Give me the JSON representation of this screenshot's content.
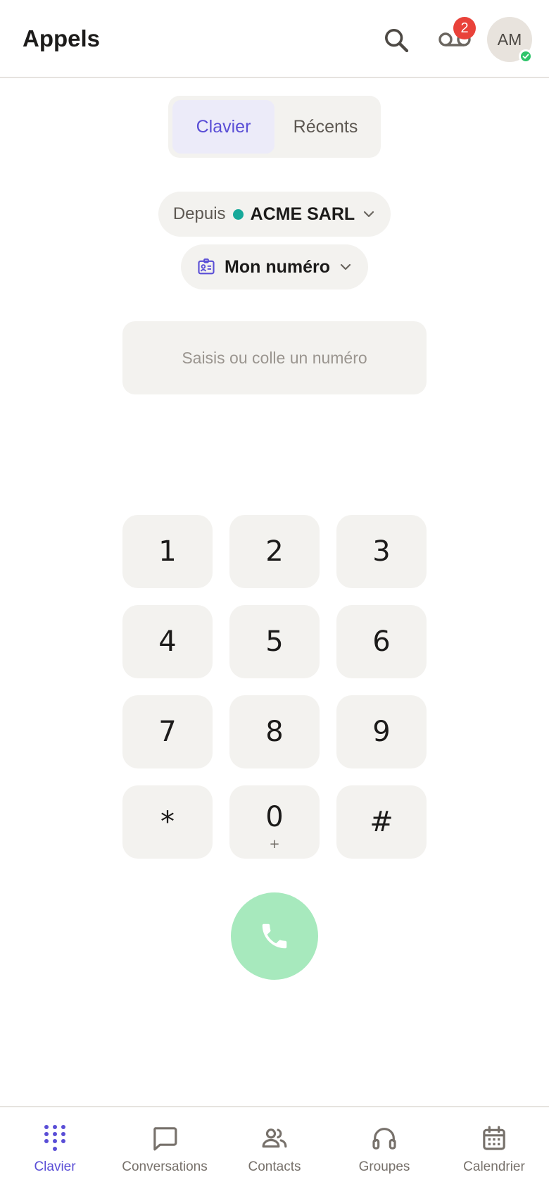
{
  "header": {
    "title": "Appels",
    "voicemail_count": "2",
    "avatar_initials": "AM"
  },
  "tabs": [
    {
      "label": "Clavier",
      "active": true
    },
    {
      "label": "Récents",
      "active": false
    }
  ],
  "caller": {
    "from_label": "Depuis",
    "company": "ACME SARL",
    "company_dot_color": "#17a99a",
    "number_label": "Mon numéro"
  },
  "dial_input": {
    "value": "",
    "placeholder": "Saisis ou colle un numéro"
  },
  "keypad": [
    {
      "digit": "1",
      "sub": ""
    },
    {
      "digit": "2",
      "sub": ""
    },
    {
      "digit": "3",
      "sub": ""
    },
    {
      "digit": "4",
      "sub": ""
    },
    {
      "digit": "5",
      "sub": ""
    },
    {
      "digit": "6",
      "sub": ""
    },
    {
      "digit": "7",
      "sub": ""
    },
    {
      "digit": "8",
      "sub": ""
    },
    {
      "digit": "9",
      "sub": ""
    },
    {
      "digit": "*",
      "sub": ""
    },
    {
      "digit": "0",
      "sub": "+"
    },
    {
      "digit": "#",
      "sub": ""
    }
  ],
  "call_button": {
    "icon": "phone-icon",
    "color": "#a7e9bd"
  },
  "nav": [
    {
      "label": "Clavier",
      "icon": "dialpad-icon",
      "active": true
    },
    {
      "label": "Conversations",
      "icon": "chat-bubble-icon",
      "active": false
    },
    {
      "label": "Contacts",
      "icon": "people-icon",
      "active": false
    },
    {
      "label": "Groupes",
      "icon": "headset-icon",
      "active": false
    },
    {
      "label": "Calendrier",
      "icon": "calendar-icon",
      "active": false
    }
  ],
  "colors": {
    "accent": "#5a4ed6",
    "badge": "#e9423a",
    "presence": "#2ec46a",
    "surface": "#f3f2ef"
  }
}
